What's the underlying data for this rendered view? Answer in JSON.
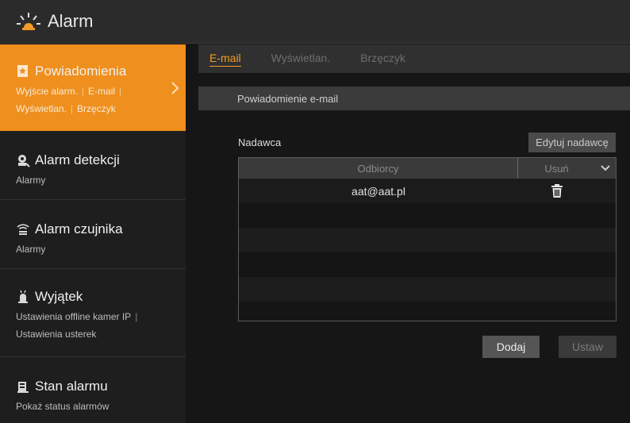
{
  "window": {
    "title": "Alarm"
  },
  "sidebar": {
    "items": [
      {
        "label": "Powiadomienia",
        "icon": "notification-icon",
        "subs": [
          "Wyjście alarm.",
          "E-mail",
          "Wyświetlan.",
          "Brzęczyk"
        ],
        "active": true
      },
      {
        "label": "Alarm detekcji",
        "icon": "motion-detection-icon",
        "subs": [
          "Alarmy"
        ],
        "active": false
      },
      {
        "label": "Alarm czujnika",
        "icon": "sensor-icon",
        "subs": [
          "Alarmy"
        ],
        "active": false
      },
      {
        "label": "Wyjątek",
        "icon": "exception-icon",
        "subs": [
          "Ustawienia offline kamer IP",
          "Ustawienia usterek"
        ],
        "active": false
      },
      {
        "label": "Stan alarmu",
        "icon": "alarm-status-icon",
        "subs": [
          "Pokaż status alarmów"
        ],
        "active": false
      }
    ]
  },
  "tabs": [
    {
      "label": "E-mail",
      "active": true
    },
    {
      "label": "Wyświetlan.",
      "active": false
    },
    {
      "label": "Brzęczyk",
      "active": false
    }
  ],
  "section": {
    "title": "Powiadomienie e-mail"
  },
  "sender": {
    "label": "Nadawca",
    "edit_button": "Edytuj nadawcę"
  },
  "recipients_table": {
    "columns": {
      "recipients": "Odbiorcy",
      "delete": "Usuń"
    },
    "rows": [
      {
        "email": "aat@aat.pl"
      }
    ]
  },
  "buttons": {
    "add": "Dodaj",
    "set": "Ustaw"
  },
  "colors": {
    "accent": "#ef8f1d",
    "tab_active": "#f29b28"
  }
}
